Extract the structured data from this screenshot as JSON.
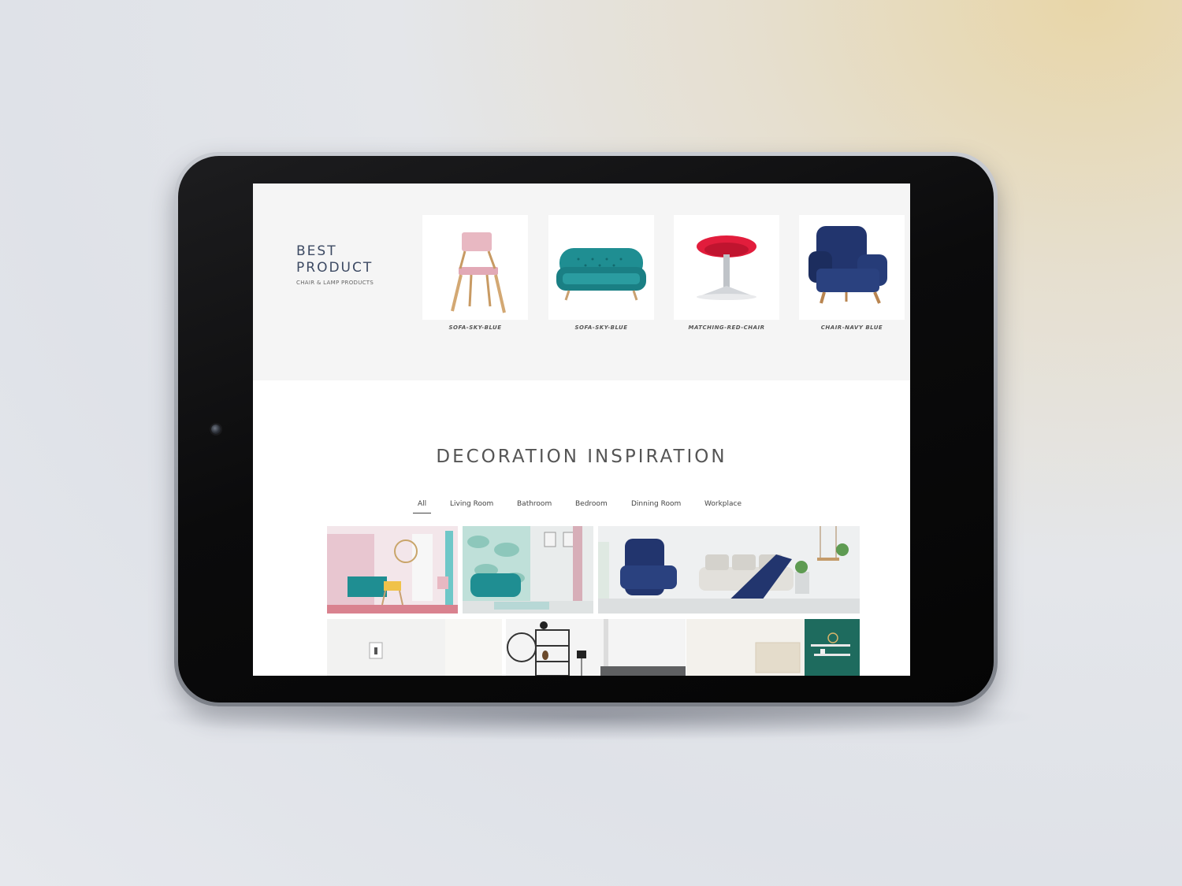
{
  "best_product": {
    "title": "BEST PRODUCT",
    "subtitle": "CHAIR & LAMP PRODUCTS",
    "prev_icon": "‹",
    "next_icon": "›",
    "products": [
      {
        "label": "SOFA-SKY-BLUE",
        "image": "pink-wooden-chair"
      },
      {
        "label": "SOFA-SKY-BLUE",
        "image": "teal-sofa"
      },
      {
        "label": "MATCHING-RED-CHAIR",
        "image": "red-egg-stool"
      },
      {
        "label": "CHAIR-NAVY BLUE",
        "image": "navy-wingback-chair"
      }
    ]
  },
  "decoration": {
    "title": "DECORATION INSPIRATION",
    "tabs": [
      {
        "label": "All",
        "active": true
      },
      {
        "label": "Living Room",
        "active": false
      },
      {
        "label": "Bathroom",
        "active": false
      },
      {
        "label": "Bedroom",
        "active": false
      },
      {
        "label": "Dinning Room",
        "active": false
      },
      {
        "label": "Workplace",
        "active": false
      }
    ]
  },
  "colors": {
    "title_text": "#3d4a63",
    "section_bg": "#f5f5f5",
    "teal": "#1f8e92",
    "navy": "#22356e",
    "red": "#e21d3c",
    "pink": "#e8b8c2"
  }
}
